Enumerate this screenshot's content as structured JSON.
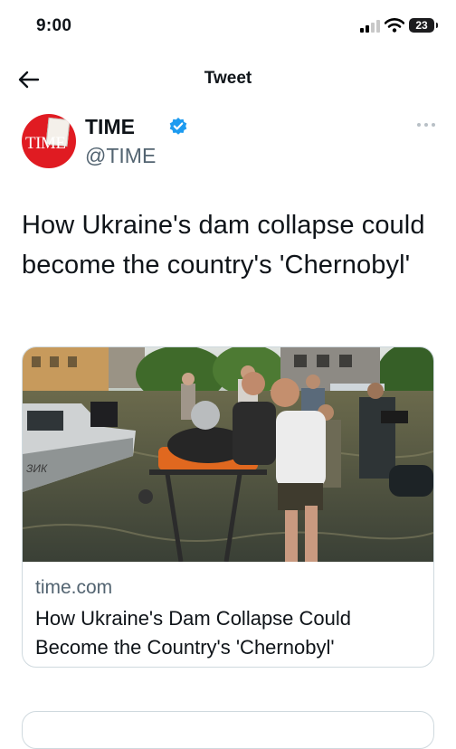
{
  "status_bar": {
    "time": "9:00",
    "battery": "23"
  },
  "nav": {
    "title": "Tweet"
  },
  "author": {
    "avatar_text": "TIME",
    "name": "TIME",
    "handle": "@TIME"
  },
  "tweet": {
    "text": "How Ukraine's dam collapse could become the country's 'Chernobyl'"
  },
  "card": {
    "domain": "time.com",
    "title": "How Ukraine's Dam Collapse Could Become the Country's 'Chernobyl'",
    "boat_text": "ЗИК"
  },
  "colors": {
    "accent": "#1d9bf0",
    "brand_red": "#e01b22",
    "muted_text": "#536471",
    "border": "#cfd9de"
  },
  "icons": [
    "back-arrow-icon",
    "verified-icon",
    "more-icon",
    "signal-icon",
    "wifi-icon",
    "battery-icon"
  ]
}
